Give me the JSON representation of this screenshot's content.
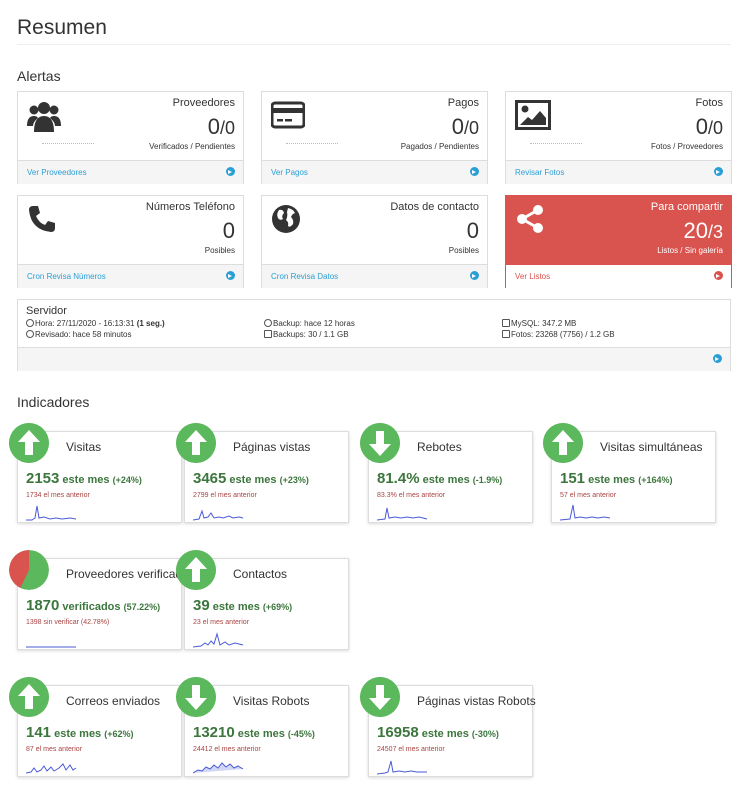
{
  "page": {
    "title": "Resumen"
  },
  "sections": {
    "alerts": "Alertas",
    "indicators": "Indicadores"
  },
  "alerts": [
    {
      "label": "Proveedores",
      "value": "0",
      "value2": "/0",
      "sub": "Verificados / Pendientes",
      "link": "Ver Proveedores",
      "icon": "users-icon"
    },
    {
      "label": "Pagos",
      "value": "0",
      "value2": "/0",
      "sub": "Pagados / Pendientes",
      "link": "Ver Pagos",
      "icon": "credit-card-icon"
    },
    {
      "label": "Fotos",
      "value": "0",
      "value2": "/0",
      "sub": "Fotos / Proveedores",
      "link": "Revisar Fotos",
      "icon": "image-icon"
    },
    {
      "label": "Números Teléfono",
      "value": "0",
      "value2": "",
      "sub": "Posibles",
      "link": "Cron Revisa Números",
      "icon": "phone-icon"
    },
    {
      "label": "Datos de contacto",
      "value": "0",
      "value2": "",
      "sub": "Posibles",
      "link": "Cron Revisa Datos",
      "icon": "globe-icon"
    },
    {
      "label": "Para compartir",
      "value": "20",
      "value2": "/3",
      "sub": "Listos / Sin galería",
      "link": "Ver Listos",
      "icon": "share-icon"
    }
  ],
  "server": {
    "title": "Servidor",
    "hora": "Hora: 27/11/2020 - 16:13:31 ",
    "hora_bold": "(1 seg.)",
    "revisado": "Revisado: hace 58 minutos",
    "backup": "Backup: hace 12 horas",
    "backups": "Backups: 30 / 1.1 GB",
    "mysql": "MySQL: 347.2 MB",
    "fotos": "Fotos: 23268 (7756) / 1.2 GB"
  },
  "indicators": [
    {
      "name": "Visitas",
      "value": "2153",
      "unit": " este mes ",
      "pct": "(+24%)",
      "prev": "1734 el mes anterior",
      "trend": "up"
    },
    {
      "name": "Páginas vistas",
      "value": "3465",
      "unit": " este mes ",
      "pct": "(+23%)",
      "prev": "2799 el mes anterior",
      "trend": "up"
    },
    {
      "name": "Rebotes",
      "value": "81.4%",
      "unit": " este mes ",
      "pct": "(-1.9%)",
      "prev": "83.3% el mes anterior",
      "trend": "down"
    },
    {
      "name": "Visitas simultáneas",
      "value": "151",
      "unit": " este mes ",
      "pct": "(+164%)",
      "prev": "57 el mes anterior",
      "trend": "up"
    },
    {
      "name": "Proveedores verificados",
      "value": "1870",
      "unit": " verificados ",
      "pct": "(57.22%)",
      "prev": "1398 sin verificar (42.78%)",
      "trend": "pie"
    },
    {
      "name": "Contactos",
      "value": "39",
      "unit": " este mes ",
      "pct": "(+69%)",
      "prev": "23 el mes anterior",
      "trend": "up"
    },
    {
      "name": "Correos enviados",
      "value": "141",
      "unit": " este mes ",
      "pct": "(+62%)",
      "prev": "87 el mes anterior",
      "trend": "up"
    },
    {
      "name": "Visitas Robots",
      "value": "13210",
      "unit": " este mes ",
      "pct": "(-45%)",
      "prev": "24412 el mes anterior",
      "trend": "down"
    },
    {
      "name": "Páginas vistas Robots",
      "value": "16958",
      "unit": " este mes ",
      "pct": "(-30%)",
      "prev": "24507 el mes anterior",
      "trend": "down"
    }
  ],
  "colors": {
    "green": "#5cb85c",
    "red": "#d9534f",
    "link": "#2a9fd6",
    "spark": "#4a5bd6"
  }
}
